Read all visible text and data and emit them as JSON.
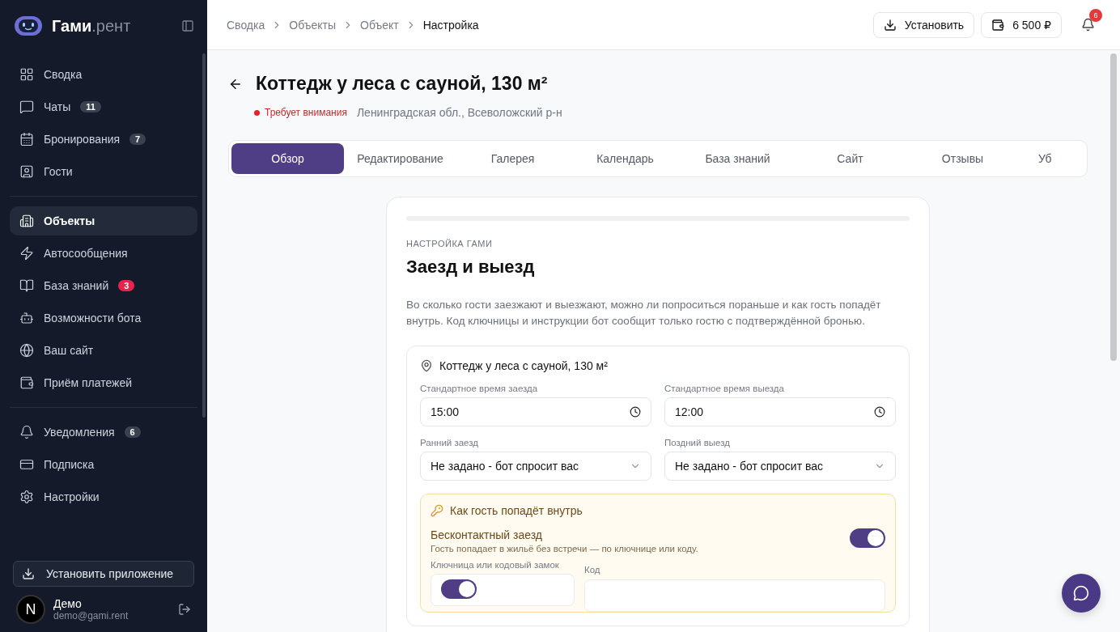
{
  "brand": {
    "name": "Гами",
    "suffix": ".рент"
  },
  "sidebar": {
    "groups": [
      [
        {
          "label": "Сводка",
          "selected": false
        },
        {
          "label": "Чаты",
          "badge": "11",
          "selected": false
        },
        {
          "label": "Бронирования",
          "badge": "7",
          "selected": false
        },
        {
          "label": "Гости",
          "selected": false
        }
      ],
      [
        {
          "label": "Объекты",
          "selected": true
        },
        {
          "label": "Автосообщения",
          "selected": false
        },
        {
          "label": "База знаний",
          "badge": "3",
          "badge_alert": true,
          "selected": false
        },
        {
          "label": "Возможности бота",
          "selected": false
        },
        {
          "label": "Ваш сайт",
          "selected": false
        },
        {
          "label": "Приём платежей",
          "selected": false
        }
      ],
      [
        {
          "label": "Уведомления",
          "badge": "6",
          "selected": false
        },
        {
          "label": "Подписка",
          "selected": false
        },
        {
          "label": "Настройки",
          "selected": false
        }
      ]
    ],
    "install_button": "Установить приложение",
    "user": {
      "initial": "N",
      "name": "Демо",
      "email": "demo@gami.rent"
    }
  },
  "breadcrumbs": [
    "Сводка",
    "Объекты",
    "Объект",
    "Настройка"
  ],
  "header": {
    "install": "Установить",
    "balance": "6 500 ₽",
    "notifications": "6"
  },
  "page": {
    "title": "Коттедж у леса с сауной, 130 м²",
    "status": "Требует внимания",
    "location": "Ленинградская обл., Всеволожский р-н"
  },
  "tabs": [
    {
      "label": "Обзор",
      "selected": true
    },
    {
      "label": "Редактирование",
      "selected": false
    },
    {
      "label": "Галерея",
      "selected": false
    },
    {
      "label": "Календарь",
      "selected": false
    },
    {
      "label": "База знаний",
      "selected": false
    },
    {
      "label": "Сайт",
      "selected": false
    },
    {
      "label": "Отзывы",
      "selected": false
    },
    {
      "label": "Уб",
      "selected": false
    }
  ],
  "card": {
    "eyebrow": "НАСТРОЙКА ГАМИ",
    "title": "Заезд и выезд",
    "description": "Во сколько гости заезжают и выезжают, можно ли попроситься пораньше и как гость попадёт внутрь. Код ключницы и инструкции бот сообщит только гостю с подтверждённой бронью.",
    "property": "Коттедж у леса с сауной, 130 м²",
    "fields": [
      {
        "kind": "time",
        "label": "Стандартное время заезда",
        "value": "15:00"
      },
      {
        "kind": "time",
        "label": "Стандартное время выезда",
        "value": "12:00"
      },
      {
        "kind": "select",
        "label": "Ранний заезд",
        "value": "Не задано - бот спросит вас"
      },
      {
        "kind": "select",
        "label": "Поздний выезд",
        "value": "Не задано - бот спросит вас"
      }
    ],
    "access": {
      "title": "Как гость попадёт внутрь",
      "contactless": {
        "label": "Бесконтактный заезд",
        "hint": "Гость попадает в жильё без встречи — по ключнице или коду.",
        "on": true
      },
      "lockbox": {
        "label": "Ключница или кодовый замок",
        "on": true
      },
      "code": {
        "label": "Код"
      }
    }
  }
}
